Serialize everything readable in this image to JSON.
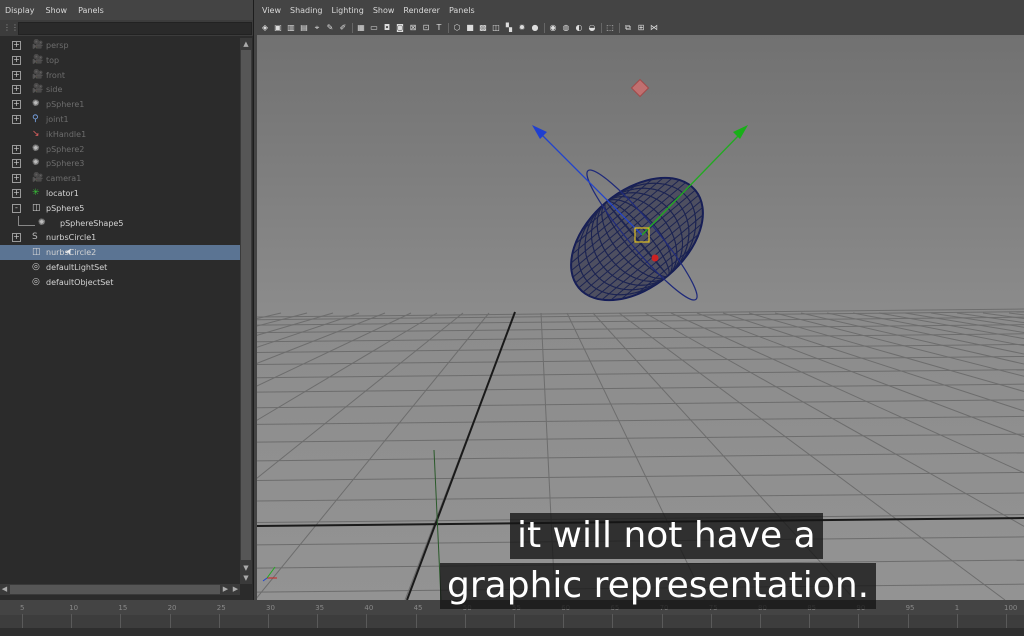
{
  "outliner": {
    "menu": [
      "Display",
      "Show",
      "Panels"
    ],
    "items": [
      {
        "label": "persp",
        "icon": "camera-icon",
        "state": "dim",
        "expander": "+"
      },
      {
        "label": "top",
        "icon": "camera-icon",
        "state": "dim",
        "expander": "+"
      },
      {
        "label": "front",
        "icon": "camera-icon",
        "state": "dim",
        "expander": "+"
      },
      {
        "label": "side",
        "icon": "camera-icon",
        "state": "dim",
        "expander": "+"
      },
      {
        "label": "pSphere1",
        "icon": "mesh-icon",
        "state": "dim",
        "expander": "+"
      },
      {
        "label": "joint1",
        "icon": "joint-icon",
        "state": "dim",
        "expander": "+"
      },
      {
        "label": "ikHandle1",
        "icon": "ik-handle-icon",
        "state": "dim",
        "expander": ""
      },
      {
        "label": "pSphere2",
        "icon": "mesh-icon",
        "state": "dim",
        "expander": "+"
      },
      {
        "label": "pSphere3",
        "icon": "mesh-icon",
        "state": "dim",
        "expander": "+"
      },
      {
        "label": "camera1",
        "icon": "camera-icon",
        "state": "dim",
        "expander": "+"
      },
      {
        "label": "locator1",
        "icon": "locator-icon",
        "state": "bright",
        "expander": "+"
      },
      {
        "label": "pSphere5",
        "icon": "transform-icon",
        "state": "bright",
        "expander": "-"
      },
      {
        "label": "pSphereShape5",
        "icon": "mesh-icon",
        "state": "bright",
        "expander": "",
        "indent": true
      },
      {
        "label": "nurbsCircle1",
        "icon": "curve-icon",
        "state": "bright",
        "expander": "+"
      },
      {
        "label": "nurbsCircle2",
        "icon": "transform-icon",
        "state": "selected",
        "expander": ""
      },
      {
        "label": "defaultLightSet",
        "icon": "set-icon",
        "state": "bright",
        "expander": ""
      },
      {
        "label": "defaultObjectSet",
        "icon": "set-icon",
        "state": "bright",
        "expander": ""
      }
    ]
  },
  "viewport": {
    "menu": [
      "View",
      "Shading",
      "Lighting",
      "Show",
      "Renderer",
      "Panels"
    ]
  },
  "timeline": {
    "ticks": [
      "5",
      "10",
      "15",
      "20",
      "25",
      "30",
      "35",
      "40",
      "45",
      "50",
      "55",
      "60",
      "65",
      "70",
      "75",
      "80",
      "85",
      "90",
      "95",
      "1",
      "100",
      "105"
    ]
  },
  "caption": {
    "line1": "it will not have a",
    "line2": "graphic representation."
  },
  "colors": {
    "selection": "#5b7493",
    "x_axis": "#cc2222",
    "y_axis": "#22aa22",
    "z_axis": "#2244cc",
    "mesh": "#1c2452"
  }
}
